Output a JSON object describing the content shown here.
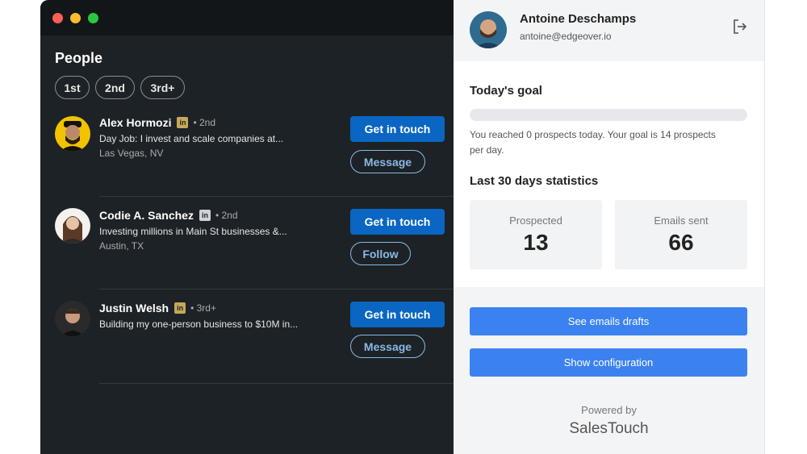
{
  "window": {
    "traffic_lights": {
      "close_color": "#fe5f57",
      "minimize_color": "#febc2e",
      "zoom_color": "#28c840"
    }
  },
  "people": {
    "title": "People",
    "filters": [
      "1st",
      "2nd",
      "3rd+"
    ],
    "list": [
      {
        "name": "Alex Hormozi",
        "degree": "• 2nd",
        "headline": "Day Job: I invest and scale companies at...",
        "location": "Las Vegas, NV",
        "primary_action": "Get in touch",
        "secondary_action": "Message",
        "linkedin_icon": "linkedin-icon"
      },
      {
        "name": "Codie A. Sanchez",
        "degree": "• 2nd",
        "headline": "Investing millions in Main St businesses &...",
        "location": "Austin, TX",
        "primary_action": "Get in touch",
        "secondary_action": "Follow",
        "linkedin_icon": "linkedin-icon"
      },
      {
        "name": "Justin Welsh",
        "degree": "• 3rd+",
        "headline": "Building my one-person business to $10M in...",
        "location": "",
        "primary_action": "Get in touch",
        "secondary_action": "Message",
        "linkedin_icon": "linkedin-icon"
      }
    ]
  },
  "panel": {
    "user": {
      "name": "Antoine Deschamps",
      "email": "antoine@edgeover.io"
    },
    "logout_icon": "logout-icon",
    "goal": {
      "title": "Today's goal",
      "progress_fraction": 0,
      "text": "You reached 0 prospects today. Your goal is 14 prospects per day."
    },
    "stats": {
      "title": "Last 30 days statistics",
      "prospected_label": "Prospected",
      "prospected_value": "13",
      "emails_label": "Emails sent",
      "emails_value": "66"
    },
    "buttons": {
      "drafts": "See emails drafts",
      "config": "Show configuration"
    },
    "footer": {
      "powered_by": "Powered by",
      "brand": "SalesTouch"
    }
  },
  "colors": {
    "accent_linkedin": "#0a66c2",
    "accent_panel": "#3b82f0",
    "dark_bg": "#1d2226"
  }
}
